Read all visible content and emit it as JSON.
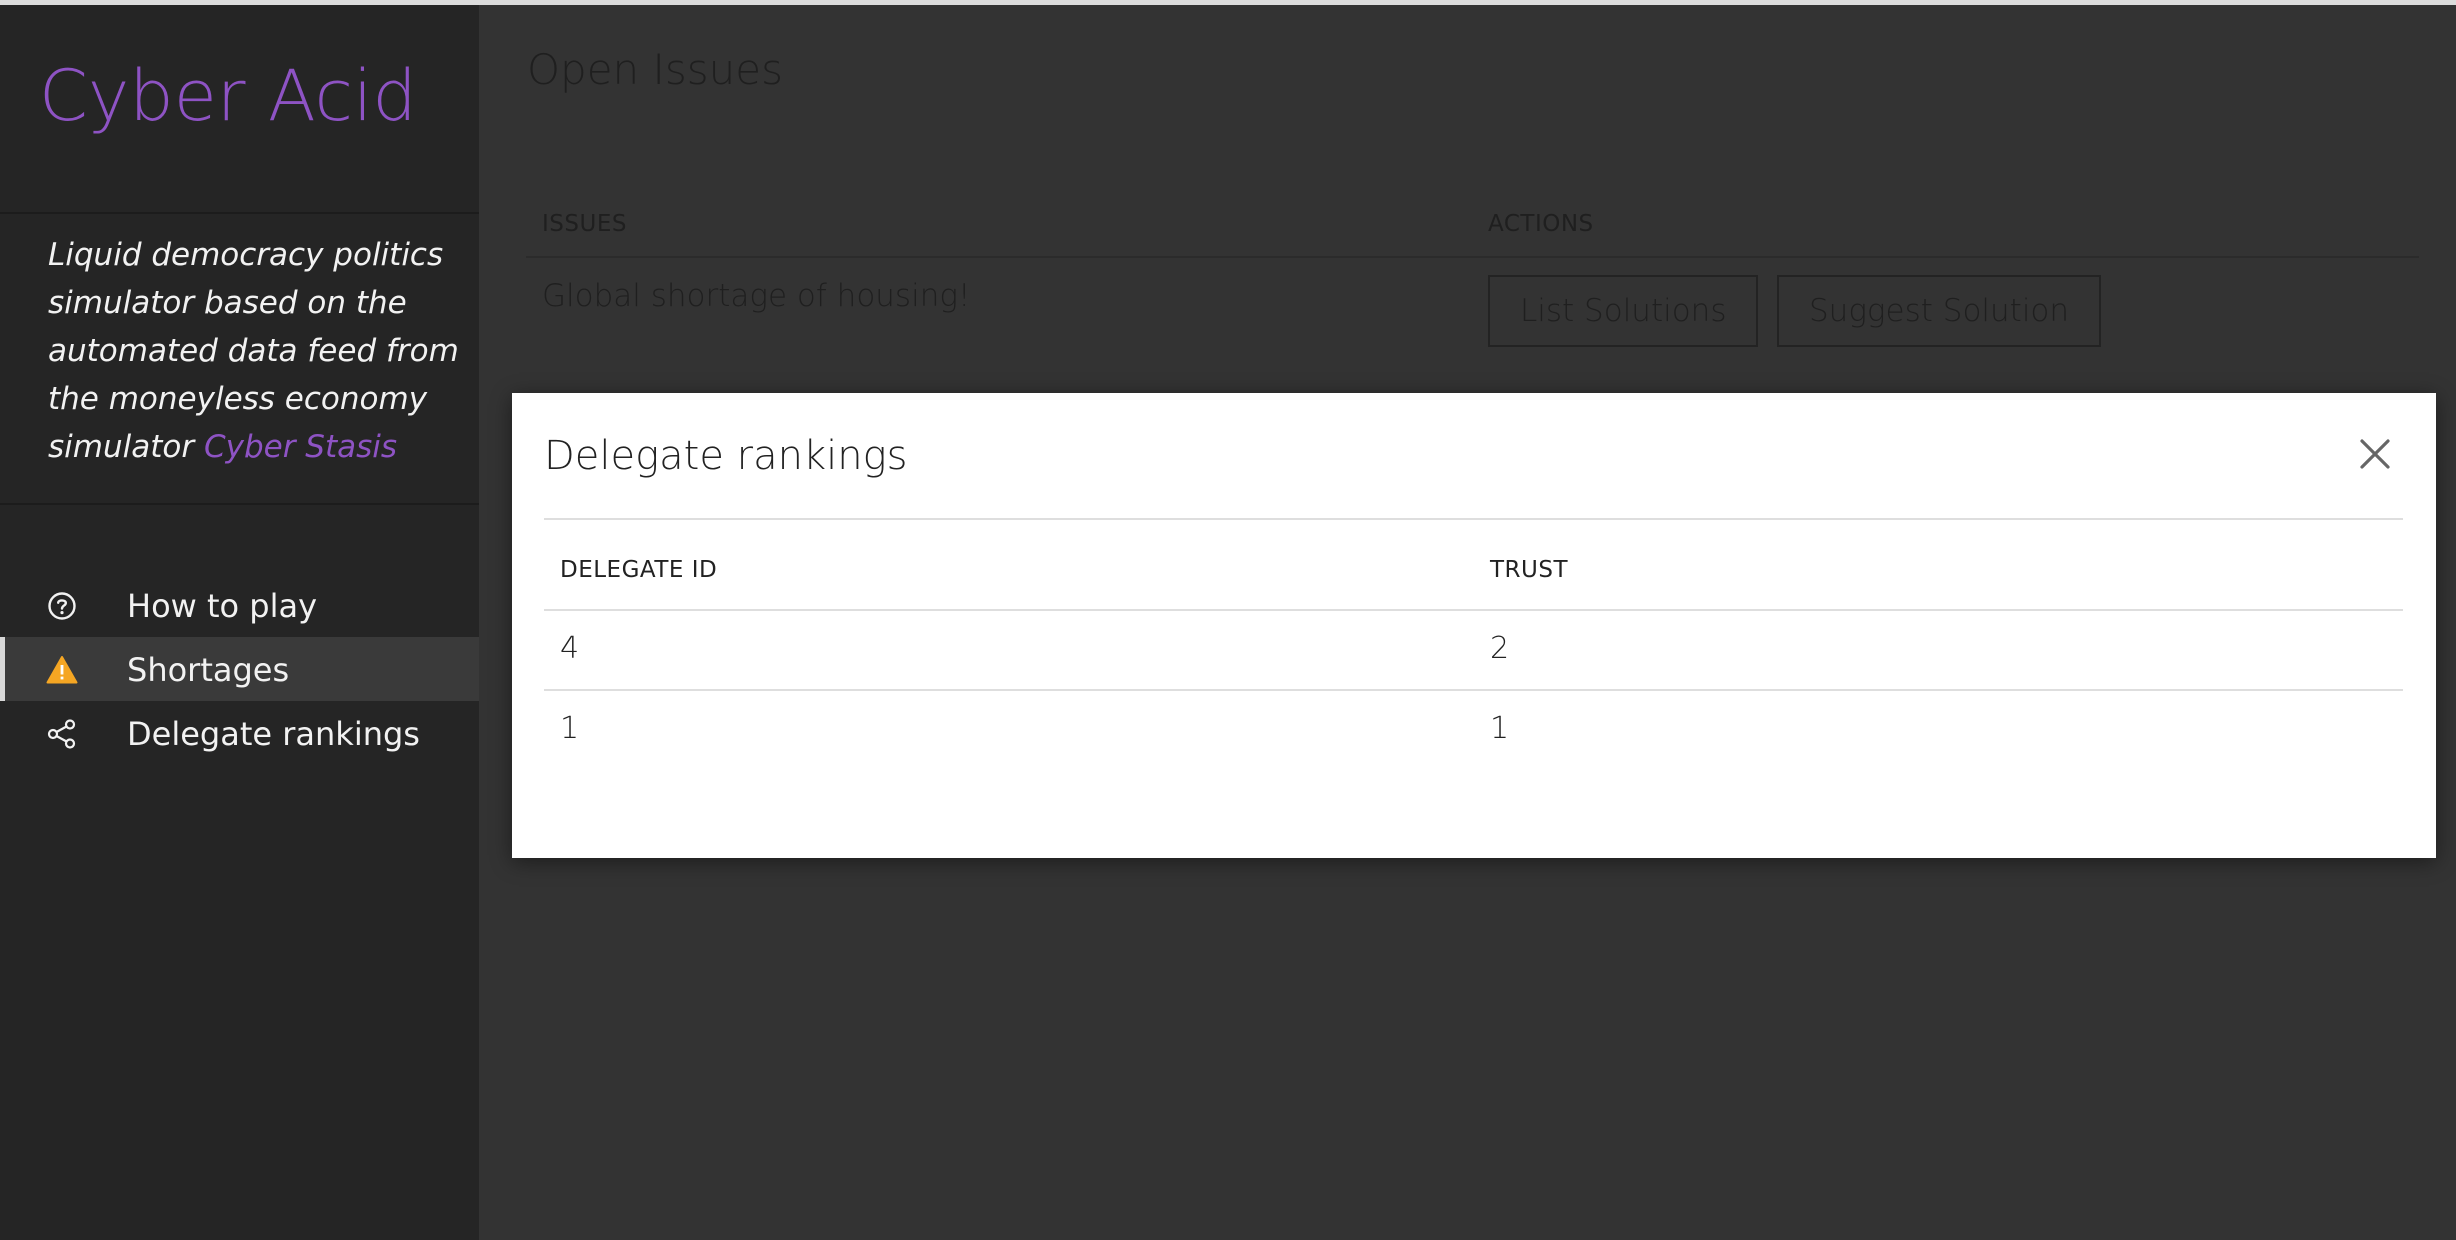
{
  "sidebar": {
    "brand": "Cyber Acid",
    "tagline": "Liquid democracy politics simulator based on the automated data feed from the moneyless economy simulator ",
    "tagline_link": "Cyber Stasis",
    "nav": [
      {
        "label": "How to play",
        "icon": "help-circle-icon",
        "active": false
      },
      {
        "label": "Shortages",
        "icon": "warning-icon",
        "active": true
      },
      {
        "label": "Delegate rankings",
        "icon": "share-icon",
        "active": false
      }
    ]
  },
  "main": {
    "title": "Open Issues",
    "issues_table": {
      "headers": [
        "ISSUES",
        "ACTIONS"
      ],
      "rows": [
        {
          "issue": "Global shortage of housing!",
          "actions": [
            "List Solutions",
            "Suggest Solution"
          ]
        }
      ]
    }
  },
  "modal": {
    "title": "Delegate rankings",
    "close_icon": "close-icon",
    "table": {
      "headers": [
        "DELEGATE ID",
        "TRUST"
      ],
      "rows": [
        {
          "id": "4",
          "trust": "2"
        },
        {
          "id": "1",
          "trust": "1"
        }
      ]
    }
  },
  "colors": {
    "brand": "#8e53c4",
    "warning": "#f5a623",
    "sidebar_bg": "#252525",
    "main_bg": "#333333"
  }
}
